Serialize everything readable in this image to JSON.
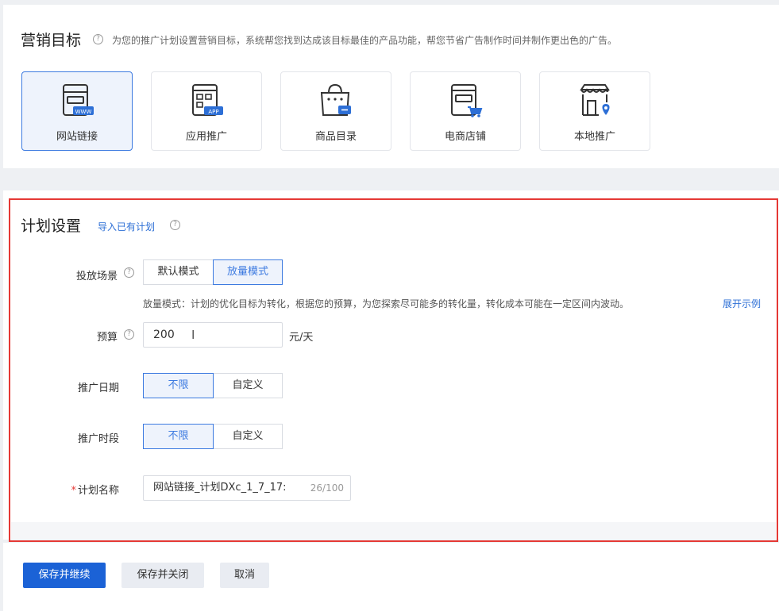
{
  "goal_section": {
    "title": "营销目标",
    "hint": "为您的推广计划设置营销目标，系统帮您找到达成该目标最佳的产品功能，帮您节省广告制作时间并制作更出色的广告。",
    "tiles": [
      {
        "label": "网站链接",
        "icon": "website-link-icon",
        "selected": true
      },
      {
        "label": "应用推广",
        "icon": "app-promotion-icon",
        "selected": false
      },
      {
        "label": "商品目录",
        "icon": "product-catalog-icon",
        "selected": false
      },
      {
        "label": "电商店铺",
        "icon": "ecommerce-store-icon",
        "selected": false
      },
      {
        "label": "本地推广",
        "icon": "local-promotion-icon",
        "selected": false
      }
    ]
  },
  "plan_section": {
    "title": "计划设置",
    "import_link": "导入已有计划",
    "scene": {
      "label": "投放场景",
      "options": [
        "默认模式",
        "放量模式"
      ],
      "selected": "放量模式",
      "description": "放量模式：计划的优化目标为转化，根据您的预算，为您探索尽可能多的转化量，转化成本可能在一定区间内波动。",
      "expand_link": "展开示例"
    },
    "budget": {
      "label": "预算",
      "value": "200",
      "unit": "元/天"
    },
    "date": {
      "label": "推广日期",
      "options": [
        "不限",
        "自定义"
      ],
      "selected": "不限"
    },
    "period": {
      "label": "推广时段",
      "options": [
        "不限",
        "自定义"
      ],
      "selected": "不限"
    },
    "name": {
      "label": "计划名称",
      "value": "网站链接_计划DXc_1_7_17:",
      "counter": "26/100"
    }
  },
  "footer": {
    "save_continue": "保存并继续",
    "save_close": "保存并关闭",
    "cancel": "取消"
  },
  "colors": {
    "accent": "#3c7ae0",
    "primary_button": "#1b62d6",
    "highlight_frame": "#e53935"
  }
}
